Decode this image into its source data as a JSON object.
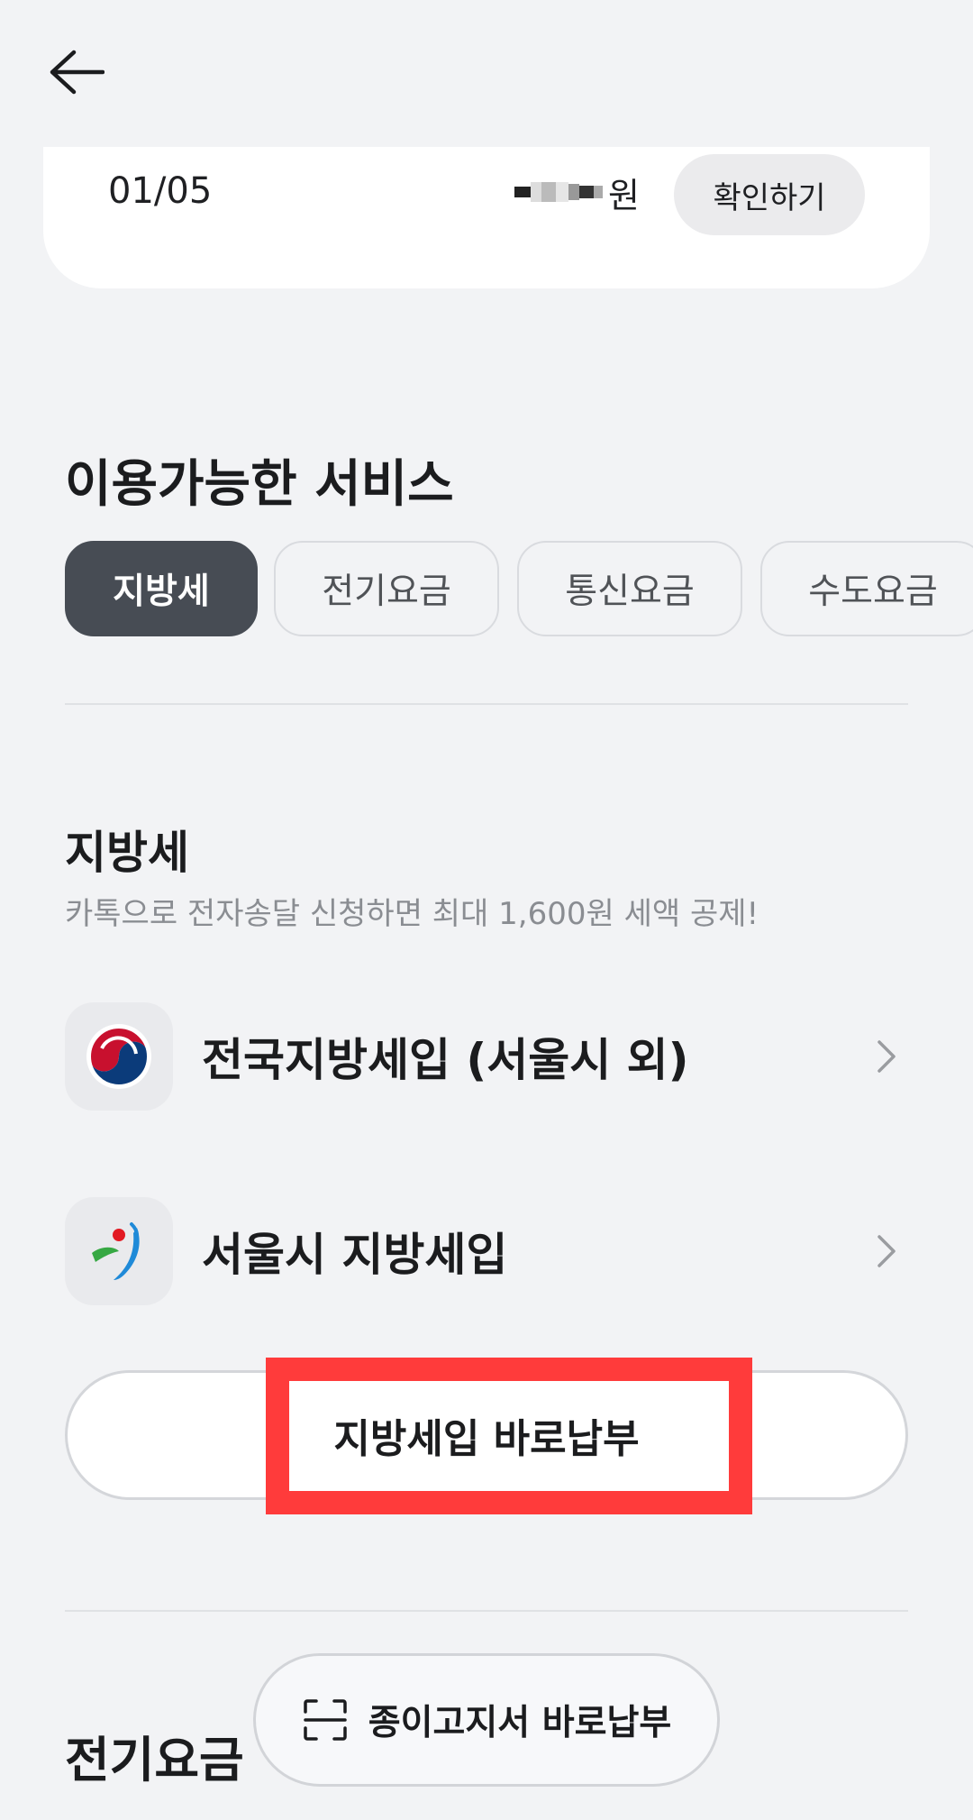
{
  "header": {
    "back_icon": "arrow-left-icon"
  },
  "bill": {
    "date": "01/05",
    "currency_suffix": "원",
    "confirm_label": "확인하기"
  },
  "services": {
    "title": "이용가능한 서비스",
    "chips": [
      {
        "label": "지방세",
        "active": true
      },
      {
        "label": "전기요금",
        "active": false
      },
      {
        "label": "통신요금",
        "active": false
      },
      {
        "label": "수도요금",
        "active": false
      }
    ]
  },
  "local_tax": {
    "title": "지방세",
    "subtitle": "카톡으로 전자송달 신청하면 최대 1,600원 세액 공제!",
    "items": [
      {
        "label": "전국지방세입 (서울시 외)",
        "icon": "korea-government-emblem-icon"
      },
      {
        "label": "서울시 지방세입",
        "icon": "seoul-city-logo-icon"
      }
    ],
    "pay_now_label": "지방세입 바로납부"
  },
  "electricity": {
    "title": "전기요금"
  },
  "floating": {
    "paper_pay_label": "종이고지서 바로납부",
    "icon": "scan-icon"
  },
  "colors": {
    "accent_chip": "#474c54",
    "highlight": "#ff3b3b",
    "background": "#f2f3f5"
  }
}
